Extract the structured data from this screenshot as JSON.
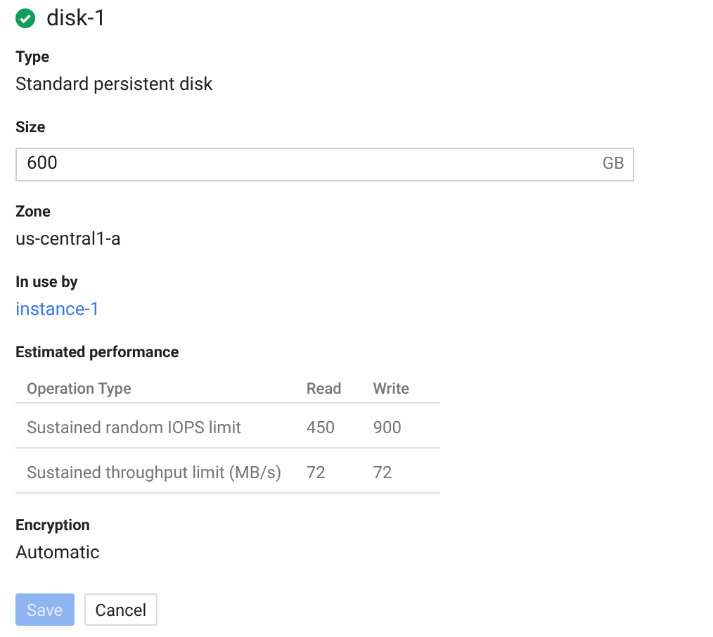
{
  "header": {
    "title": "disk-1",
    "healthy": true
  },
  "type": {
    "label": "Type",
    "value": "Standard persistent disk"
  },
  "size": {
    "label": "Size",
    "value": "600",
    "unit": "GB"
  },
  "zone": {
    "label": "Zone",
    "value": "us-central1-a"
  },
  "in_use_by": {
    "label": "In use by",
    "link": "instance-1"
  },
  "performance": {
    "label": "Estimated performance",
    "columns": [
      "Operation Type",
      "Read",
      "Write"
    ],
    "rows": [
      {
        "cells": [
          "Sustained random IOPS limit",
          "450",
          "900"
        ]
      },
      {
        "cells": [
          "Sustained throughput limit (MB/s)",
          "72",
          "72"
        ]
      }
    ]
  },
  "encryption": {
    "label": "Encryption",
    "value": "Automatic"
  },
  "buttons": [
    {
      "label": "Save",
      "kind": "primary",
      "disabled": true
    },
    {
      "label": "Cancel",
      "kind": "secondary",
      "disabled": false
    }
  ]
}
